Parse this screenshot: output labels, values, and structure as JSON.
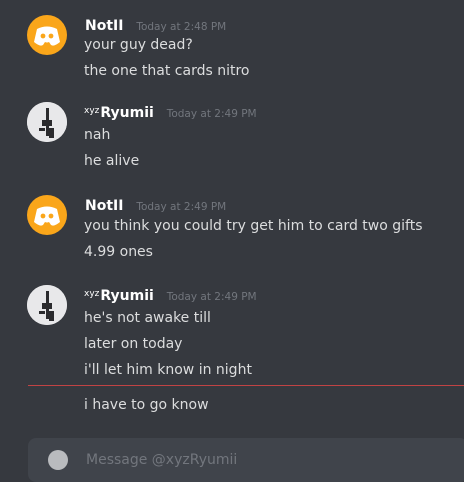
{
  "messages": [
    {
      "author": "NotII",
      "prefix": "",
      "timestamp": "Today at 2:48 PM",
      "avatar_icon": "discord-logo-icon",
      "lines": [
        "your guy dead?",
        "the one that cards nitro"
      ]
    },
    {
      "author": "Ryumii",
      "prefix": "xyz",
      "timestamp": "Today at 2:49 PM",
      "avatar_icon": "photo-avatar-icon",
      "lines": [
        "nah",
        "he alive"
      ]
    },
    {
      "author": "NotII",
      "prefix": "",
      "timestamp": "Today at 2:49 PM",
      "avatar_icon": "discord-logo-icon",
      "lines": [
        "you think you could try get him to card two gifts",
        "4.99 ones"
      ]
    },
    {
      "author": "Ryumii",
      "prefix": "xyz",
      "timestamp": "Today at 2:49 PM",
      "avatar_icon": "photo-avatar-icon",
      "lines": [
        "he's not awake till",
        "later on today",
        "i'll let him know in night",
        "i have to go know"
      ]
    }
  ],
  "composer": {
    "placeholder": "Message @xyzRyumii"
  },
  "colors": {
    "background": "#36393f",
    "discord_avatar": "#faa61a",
    "new_messages_divider": "#f04747",
    "username": "#ffffff",
    "timestamp": "#72767d",
    "message_text": "#dcddde"
  }
}
